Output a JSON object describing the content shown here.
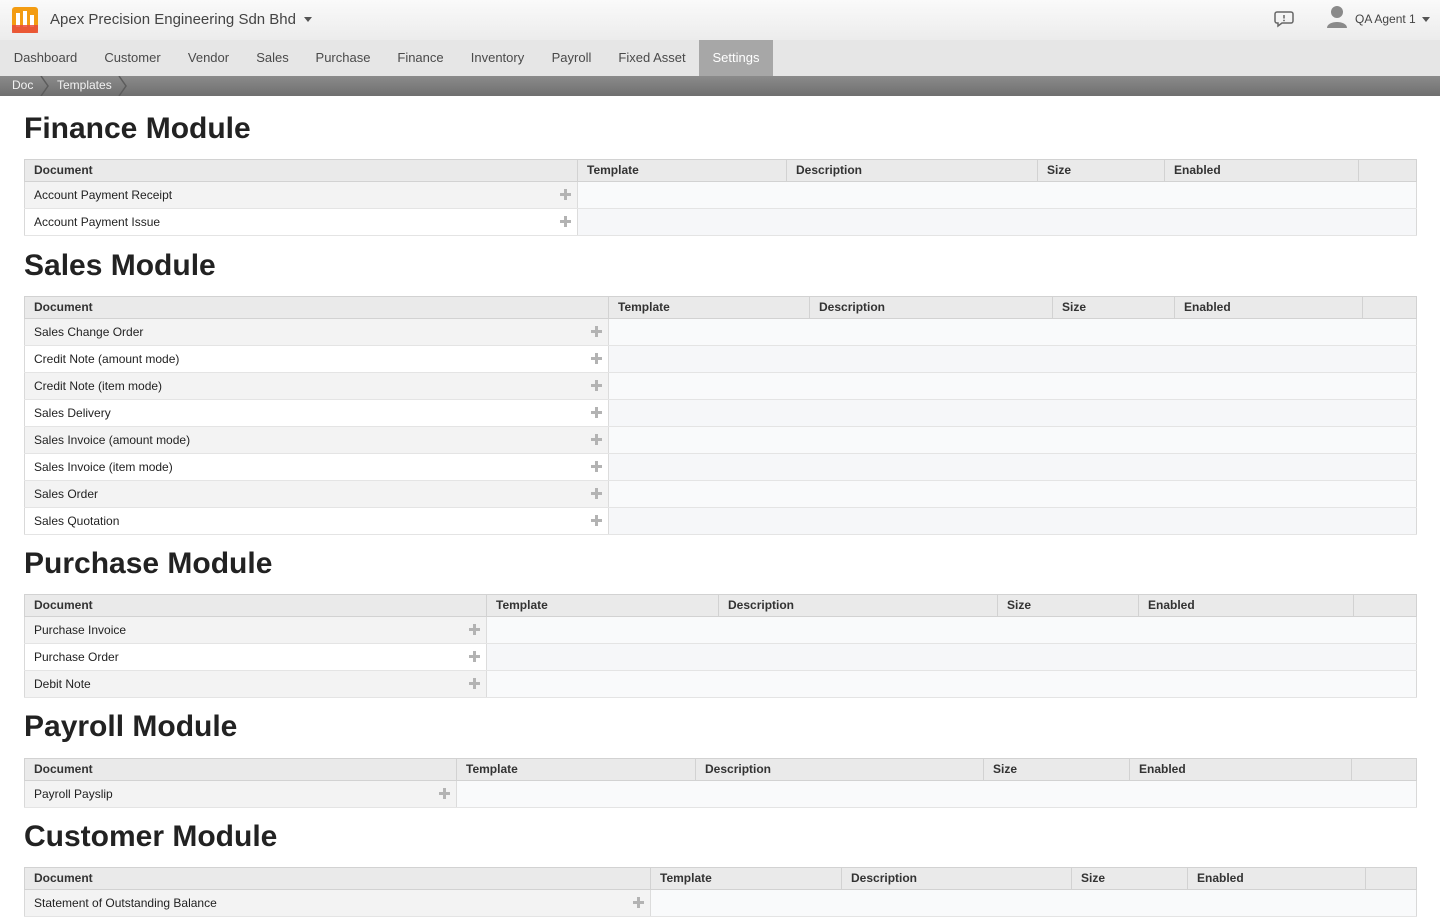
{
  "app": {
    "company": "Apex Precision Engineering Sdn Bhd",
    "user": "QA Agent 1",
    "icons": {
      "logo": "app-logo",
      "chat": "chat-icon",
      "user": "user-icon"
    }
  },
  "nav": {
    "items": [
      "Dashboard",
      "Customer",
      "Vendor",
      "Sales",
      "Purchase",
      "Finance",
      "Inventory",
      "Payroll",
      "Fixed Asset",
      "Settings"
    ],
    "active": "Settings"
  },
  "breadcrumb": [
    "Doc",
    "Templates"
  ],
  "columns": [
    "Document",
    "Template",
    "Description",
    "Size",
    "Enabled"
  ],
  "modules": [
    {
      "title": "Finance Module",
      "docs": [
        "Account Payment Receipt",
        "Account Payment Issue"
      ]
    },
    {
      "title": "Sales Module",
      "docs": [
        "Sales Change Order",
        "Credit Note (amount mode)",
        "Credit Note (item mode)",
        "Sales Delivery",
        "Sales Invoice (amount mode)",
        "Sales Invoice (item mode)",
        "Sales Order",
        "Sales Quotation"
      ]
    },
    {
      "title": "Purchase Module",
      "docs": [
        "Purchase Invoice",
        "Purchase Order",
        "Debit Note"
      ]
    },
    {
      "title": "Payroll Module",
      "docs": [
        "Payroll Payslip"
      ]
    },
    {
      "title": "Customer Module",
      "docs": [
        "Statement of Outstanding Balance"
      ]
    }
  ],
  "colors": {
    "nav_active": "#a7a7a7",
    "breadcrumb_bar": "#7d7d7d",
    "header_bg": "#eaeaea"
  }
}
